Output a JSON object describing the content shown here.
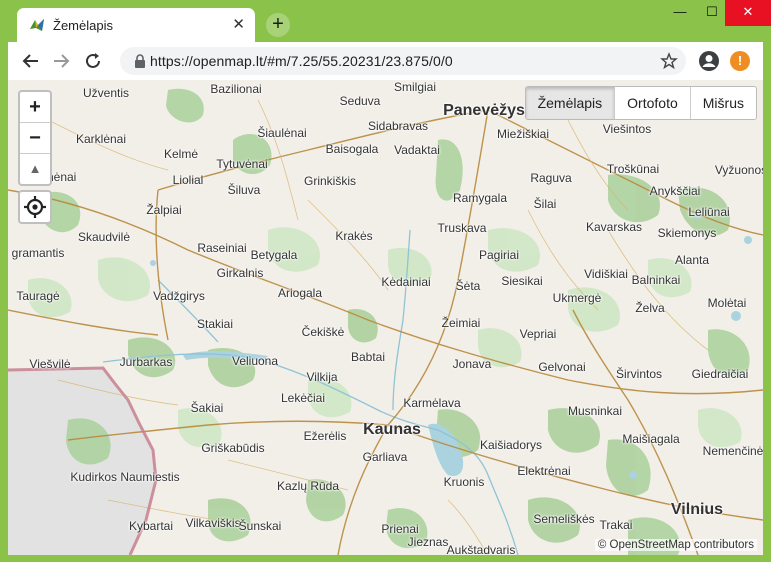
{
  "tab": {
    "title": "Žemėlapis",
    "close": "✕",
    "new_tab": "+"
  },
  "window_controls": {
    "minimize": "—",
    "maximize": "☐",
    "close": "✕"
  },
  "address_bar": {
    "url": "https://openmap.lt/#m/7.25/55.20231/23.875/0/0"
  },
  "update_badge": "!",
  "zoom": {
    "in": "+",
    "out": "−",
    "reset": "▲"
  },
  "layers": [
    {
      "label": "Žemėlapis",
      "active": true
    },
    {
      "label": "Ortofoto",
      "active": false
    },
    {
      "label": "Mišrus",
      "active": false
    }
  ],
  "attribution": "© OpenStreetMap contributors",
  "colors": {
    "frame": "#8bc34a",
    "land": "#f2efe9",
    "forest": "#add19e",
    "wetland": "#bcdcb4",
    "water": "#aad3df",
    "road": "#b8893a",
    "border": "#c77f8f"
  },
  "places": [
    {
      "name": "Bazilionai",
      "type": "village"
    },
    {
      "name": "Užventis",
      "type": "village"
    },
    {
      "name": "Seduva",
      "type": "village"
    },
    {
      "name": "Smilgiai",
      "type": "village"
    },
    {
      "name": "Panevėžys",
      "type": "city"
    },
    {
      "name": "Miežiškiai",
      "type": "village"
    },
    {
      "name": "Viešintos",
      "type": "village"
    },
    {
      "name": "Karklėnai",
      "type": "village"
    },
    {
      "name": "Šiaulėnai",
      "type": "village"
    },
    {
      "name": "Sidabravas",
      "type": "village"
    },
    {
      "name": "Kelmė",
      "type": "village"
    },
    {
      "name": "Baisogala",
      "type": "village"
    },
    {
      "name": "Vadaktai",
      "type": "village"
    },
    {
      "name": "Troškūnai",
      "type": "village"
    },
    {
      "name": "Vyžuonos",
      "type": "village"
    },
    {
      "name": "Tytuvėnai",
      "type": "village"
    },
    {
      "name": "Kaltinėnai",
      "type": "village"
    },
    {
      "name": "Liolial",
      "type": "village"
    },
    {
      "name": "Grinkiškis",
      "type": "village"
    },
    {
      "name": "Raguva",
      "type": "village"
    },
    {
      "name": "Anykščiai",
      "type": "village"
    },
    {
      "name": "Šiluva",
      "type": "village"
    },
    {
      "name": "Ramygala",
      "type": "village"
    },
    {
      "name": "Šilai",
      "type": "village"
    },
    {
      "name": "Žalpiai",
      "type": "village"
    },
    {
      "name": "Leliūnai",
      "type": "village"
    },
    {
      "name": "Kavarskas",
      "type": "village"
    },
    {
      "name": "Truskava",
      "type": "village"
    },
    {
      "name": "Skiemonys",
      "type": "village"
    },
    {
      "name": "Skaudvilė",
      "type": "village"
    },
    {
      "name": "Krakės",
      "type": "village"
    },
    {
      "name": "Raseiniai",
      "type": "village"
    },
    {
      "name": "Pagiriai",
      "type": "village"
    },
    {
      "name": "Alanta",
      "type": "village"
    },
    {
      "name": "Betygala",
      "type": "village"
    },
    {
      "name": "gramantis",
      "type": "village"
    },
    {
      "name": "Girkalnis",
      "type": "village"
    },
    {
      "name": "Vidiškiai",
      "type": "village"
    },
    {
      "name": "Siesikai",
      "type": "village"
    },
    {
      "name": "Kėdainiai",
      "type": "village"
    },
    {
      "name": "Balninkai",
      "type": "village"
    },
    {
      "name": "Šėta",
      "type": "village"
    },
    {
      "name": "Ariogala",
      "type": "village"
    },
    {
      "name": "Tauragė",
      "type": "village"
    },
    {
      "name": "Vadžgirys",
      "type": "village"
    },
    {
      "name": "Ukmergė",
      "type": "village"
    },
    {
      "name": "Molėtai",
      "type": "village"
    },
    {
      "name": "Želva",
      "type": "village"
    },
    {
      "name": "Stakiai",
      "type": "village"
    },
    {
      "name": "Žeimiai",
      "type": "village"
    },
    {
      "name": "Čekiškė",
      "type": "village"
    },
    {
      "name": "Vepriai",
      "type": "village"
    },
    {
      "name": "Babtai",
      "type": "village"
    },
    {
      "name": "Viešvilė",
      "type": "village"
    },
    {
      "name": "Jurbarkas",
      "type": "village"
    },
    {
      "name": "Veliuona",
      "type": "village"
    },
    {
      "name": "Jonava",
      "type": "village"
    },
    {
      "name": "Gelvonai",
      "type": "village"
    },
    {
      "name": "Vilkija",
      "type": "village"
    },
    {
      "name": "Širvintos",
      "type": "village"
    },
    {
      "name": "Giedraičiai",
      "type": "village"
    },
    {
      "name": "Lekėčiai",
      "type": "village"
    },
    {
      "name": "Karmėlava",
      "type": "village"
    },
    {
      "name": "Šakiai",
      "type": "village"
    },
    {
      "name": "Musninkai",
      "type": "village"
    },
    {
      "name": "Kaunas",
      "type": "city"
    },
    {
      "name": "Ežerėlis",
      "type": "village"
    },
    {
      "name": "Maišiagala",
      "type": "village"
    },
    {
      "name": "Griškabūdis",
      "type": "village"
    },
    {
      "name": "Kaišiadorys",
      "type": "village"
    },
    {
      "name": "Nemenčinė",
      "type": "village"
    },
    {
      "name": "Garliava",
      "type": "village"
    },
    {
      "name": "Elektrėnai",
      "type": "village"
    },
    {
      "name": "Kudirkos Naumiestis",
      "type": "village"
    },
    {
      "name": "Kruonis",
      "type": "village"
    },
    {
      "name": "Kazlų Rūda",
      "type": "village"
    },
    {
      "name": "Semeliškės",
      "type": "village"
    },
    {
      "name": "Vilnius",
      "type": "city"
    },
    {
      "name": "Kybartai",
      "type": "village"
    },
    {
      "name": "Vilkaviškis",
      "type": "village"
    },
    {
      "name": "Šunskai",
      "type": "village"
    },
    {
      "name": "Prienai",
      "type": "village"
    },
    {
      "name": "Trakai",
      "type": "village"
    },
    {
      "name": "Jieznas",
      "type": "village"
    },
    {
      "name": "Aukštadvaris",
      "type": "village"
    }
  ]
}
